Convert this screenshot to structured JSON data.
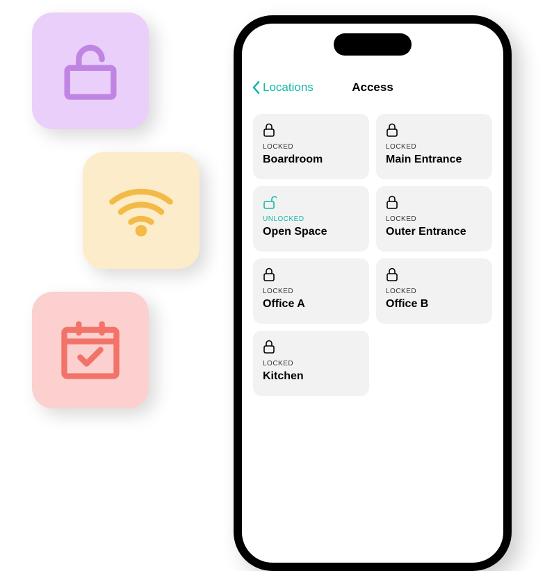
{
  "features": {
    "card1": {
      "icon": "unlock-icon",
      "color": "#C084E3"
    },
    "card2": {
      "icon": "wifi-icon",
      "color": "#F3BA49"
    },
    "card3": {
      "icon": "calendar-check-icon",
      "color": "#F27368"
    }
  },
  "phone": {
    "nav": {
      "back_label": "Locations",
      "title": "Access"
    },
    "status_locked": "LOCKED",
    "status_unlocked": "UNLOCKED",
    "tiles": [
      {
        "name": "Boardroom",
        "locked": true
      },
      {
        "name": "Main Entrance",
        "locked": true
      },
      {
        "name": "Open Space",
        "locked": false
      },
      {
        "name": "Outer Entrance",
        "locked": true
      },
      {
        "name": "Office A",
        "locked": true
      },
      {
        "name": "Office B",
        "locked": true
      },
      {
        "name": "Kitchen",
        "locked": true
      }
    ]
  },
  "colors": {
    "accent": "#14B8A6",
    "tile_bg": "#F2F2F2"
  }
}
